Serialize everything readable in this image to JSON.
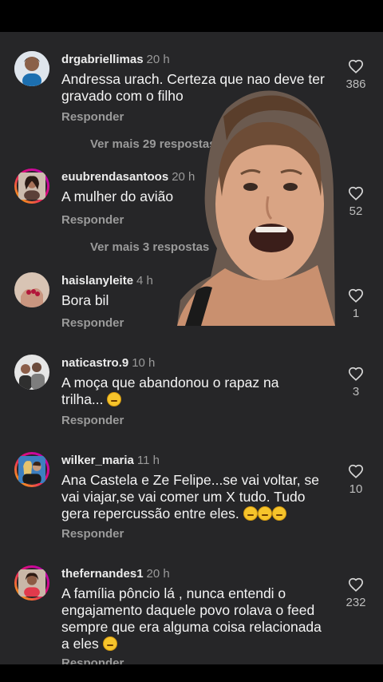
{
  "comments": [
    {
      "username": "drgabriellimas",
      "time": "20 h",
      "text": "Andressa urach. Certeza que nao deve ter gravado com o filho",
      "reply": "Responder",
      "likes": "386",
      "more": "Ver mais 29 respostas"
    },
    {
      "username": "euubrendasantoos",
      "time": "20 h",
      "text": "A mulher do avião",
      "reply": "Responder",
      "likes": "52",
      "more": "Ver mais 3 respostas"
    },
    {
      "username": "haislanyleite",
      "time": "4 h",
      "text": "Bora bil",
      "reply": "Responder",
      "likes": "1"
    },
    {
      "username": "naticastro.9",
      "time": "10 h",
      "text": "A moça que abandonou o rapaz na trilha...",
      "reply": "Responder",
      "likes": "3"
    },
    {
      "username": "wilker_maria",
      "time": "11 h",
      "text": "Ana Castela e Ze Felipe...se vai voltar, se vai viajar,se vai comer um X tudo. Tudo gera repercussão entre eles.",
      "reply": "Responder",
      "likes": "10"
    },
    {
      "username": "thefernandes1",
      "time": "20 h",
      "text": "A família pôncio lá , nunca entendi o engajamento daquele povo rolava o feed sempre que era alguma coisa relacionada a eles",
      "reply": "Responder",
      "likes": "232"
    }
  ],
  "icons": {
    "like": "heart-outline-icon",
    "emoji": "smiling-face-emoji-icon"
  }
}
